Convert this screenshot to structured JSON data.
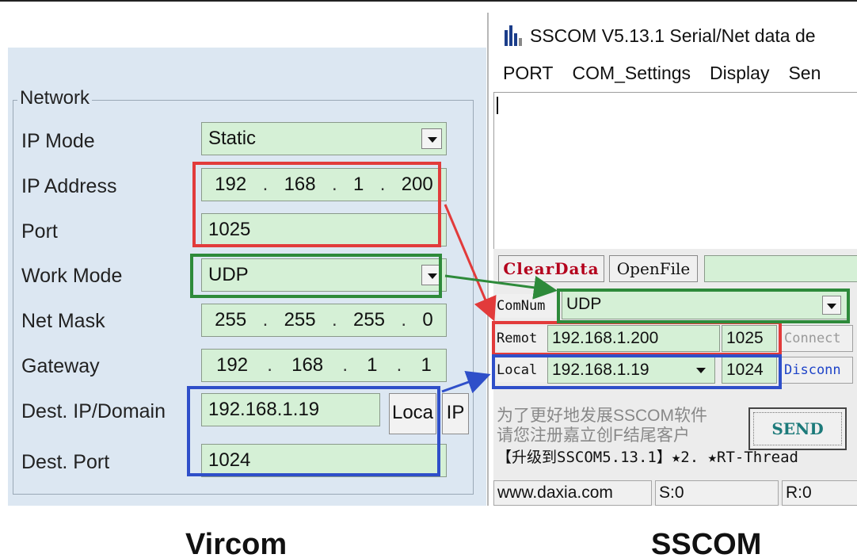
{
  "vircom": {
    "group_title": "Network",
    "labels": [
      "IP Mode",
      "IP Address",
      "Port",
      "Work Mode",
      "Net Mask",
      "Gateway",
      "Dest. IP/Domain",
      "Dest. Port"
    ],
    "ip_mode": "Static",
    "ip_address": [
      "192",
      "168",
      "1",
      "200"
    ],
    "port": "1025",
    "work_mode": "UDP",
    "net_mask": [
      "255",
      "255",
      "255",
      "0"
    ],
    "gateway": [
      "192",
      "168",
      "1",
      "1"
    ],
    "dest_ip": "192.168.1.19",
    "local_button": "Loca",
    "ip_button": "IP",
    "dest_port": "1024"
  },
  "sscom": {
    "title": "SSCOM V5.13.1 Serial/Net data de",
    "menu": [
      "PORT",
      "COM_Settings",
      "Display",
      "Sen"
    ],
    "clear_data": "ClearData",
    "open_file": "OpenFile",
    "comnum_label": "ComNum",
    "comnum_value": "UDP",
    "remote_label": "Remot",
    "remote_ip": "192.168.1.200",
    "remote_port": "1025",
    "connect_button": "Connect",
    "local_label": "Local",
    "local_ip": "192.168.1.19",
    "local_port": "1024",
    "disconnect_button": "Disconn",
    "promo_line1": "为了更好地发展SSCOM软件",
    "promo_line2": "请您注册嘉立创F结尾客户",
    "send_button": "SEND",
    "upgrade_text": "【升级到SSCOM5.13.1】★2. ★RT-Thread",
    "status_site": "www.daxia.com",
    "status_sent": "S:0",
    "status_recv": "R:0"
  },
  "captions": {
    "left": "Vircom",
    "right": "SSCOM"
  },
  "colors": {
    "field_bg": "#d5f0d6",
    "panel_bg": "#dce7f2",
    "highlight_red": "#e23b3b",
    "highlight_green": "#2d8a3a",
    "highlight_blue": "#2f4fc9"
  }
}
